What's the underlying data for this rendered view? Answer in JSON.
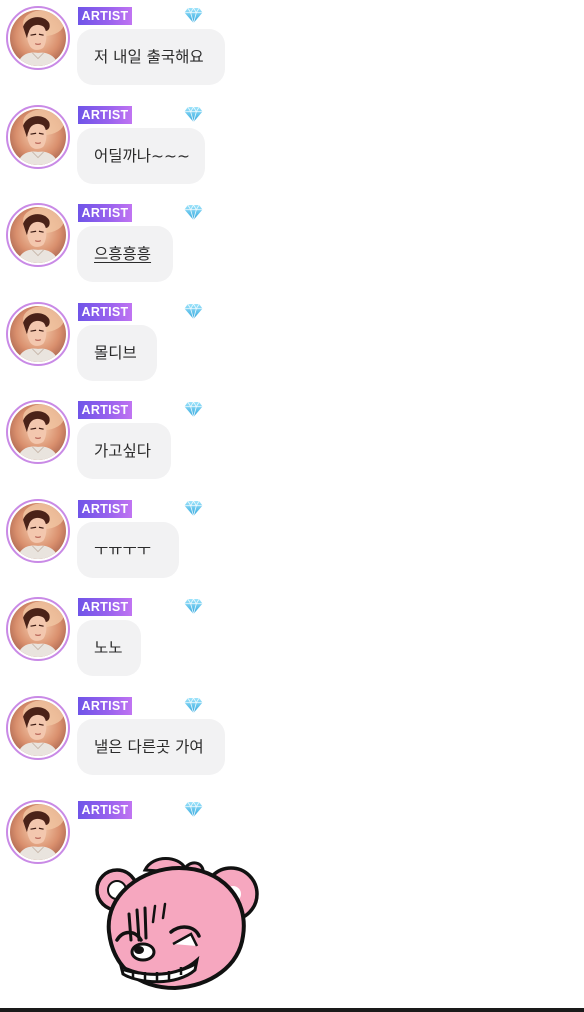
{
  "badge_label": "ARTIST",
  "colors": {
    "badge_gradient_start": "#6f54e8",
    "badge_gradient_end": "#c074f2",
    "bubble_background": "#f2f2f3",
    "avatar_ring": "#c98ae6",
    "gem": "#5cc8ee",
    "sticker_pink": "#f6a7bf"
  },
  "icons": {
    "tier": "diamond-icon",
    "sticker": "pink-bear-sticker"
  },
  "messages": [
    {
      "text": "저 내일 출국해요"
    },
    {
      "text": "어딜까나~~~"
    },
    {
      "text": "으흥흥흥",
      "underlined": true
    },
    {
      "text": "몰디브"
    },
    {
      "text": "가고싶다"
    },
    {
      "text": "ㅜㅠㅜㅜ"
    },
    {
      "text": "노노"
    },
    {
      "text": "낼은 다른곳 가여"
    }
  ]
}
